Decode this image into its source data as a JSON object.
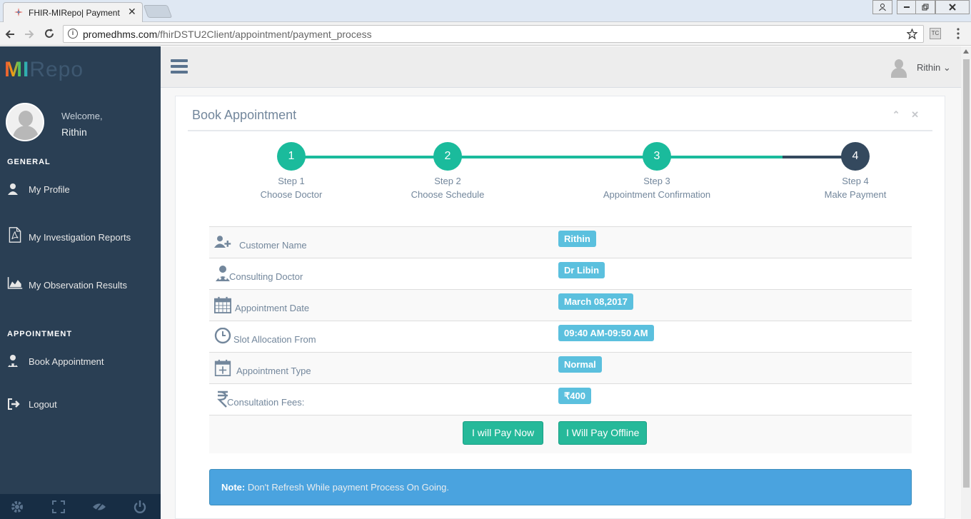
{
  "browser": {
    "tab_title": "FHIR-MIRepo| Payment",
    "url_domain": "promedhms.com",
    "url_path": "/fhirDSTU2Client/appointment/payment_process",
    "tab_close": "✕"
  },
  "sidebar": {
    "logo_m": "MI",
    "logo_rest": "Repo",
    "welcome": "Welcome,",
    "user_name": "Rithin",
    "section_general": "GENERAL",
    "section_appointment": "APPOINTMENT",
    "items": [
      {
        "label": "My Profile",
        "icon": "user-icon"
      },
      {
        "label": "My Investigation Reports",
        "icon": "pdf-file-icon"
      },
      {
        "label": "My Observation Results",
        "icon": "area-chart-icon"
      },
      {
        "label": "Book Appointment",
        "icon": "user-md-icon"
      },
      {
        "label": "Logout",
        "icon": "sign-out-icon"
      }
    ],
    "footer_icons": [
      "gear-icon",
      "fullscreen-icon",
      "eye-slash-icon",
      "power-icon"
    ]
  },
  "topnav": {
    "user_name": "Rithin",
    "caret": "⌄"
  },
  "panel": {
    "title": "Book Appointment",
    "collapse_icon": "⌃",
    "close_icon": "✕"
  },
  "wizard": {
    "steps": [
      {
        "number": "1",
        "title": "Step 1",
        "desc": "Choose Doctor"
      },
      {
        "number": "2",
        "title": "Step 2",
        "desc": "Choose Schedule"
      },
      {
        "number": "3",
        "title": "Step 3",
        "desc": "Appointment Confirmation"
      },
      {
        "number": "4",
        "title": "Step 4",
        "desc": "Make Payment"
      }
    ],
    "done_color": "#1ABB9C",
    "current_color": "#34495E"
  },
  "details": {
    "rows": [
      {
        "label": "Customer Name",
        "value": "Rithin",
        "icon": "user-plus-icon"
      },
      {
        "label": "Consulting Doctor",
        "value": "Dr Libin",
        "icon": "user-md-icon"
      },
      {
        "label": "Appointment Date",
        "value": "March 08,2017",
        "icon": "calendar-icon"
      },
      {
        "label": "Slot Allocation From",
        "value": "09:40 AM-09:50 AM",
        "icon": "clock-icon"
      },
      {
        "label": "Appointment Type",
        "value": "Normal",
        "icon": "calendar-plus-icon"
      },
      {
        "label": "Consultation Fees:",
        "value": "₹400",
        "icon": "rupee-icon"
      }
    ],
    "pay_now": "I will Pay Now",
    "pay_offline": "I Will Pay Offline"
  },
  "note": {
    "prefix": "Note:",
    "text": " Don't Refresh While payment Process On Going."
  }
}
